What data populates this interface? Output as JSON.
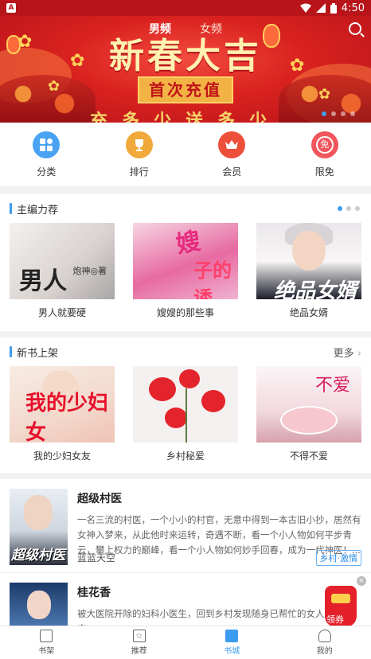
{
  "status_bar": {
    "time": "4:50"
  },
  "banner": {
    "tabs": [
      {
        "label": "男频"
      },
      {
        "label": "女频"
      }
    ],
    "title": "新春大吉",
    "button_label": "首次充值",
    "bottom_text": "充多少送多少"
  },
  "quick_nav": [
    {
      "label": "分类",
      "icon": "category-icon",
      "color": "#4aa3f2"
    },
    {
      "label": "排行",
      "icon": "trophy-icon",
      "color": "#f0a93a"
    },
    {
      "label": "会员",
      "icon": "crown-icon",
      "color": "#ee4f3b"
    },
    {
      "label": "限免",
      "icon": "free-icon",
      "color": "#f0565c"
    }
  ],
  "editor_picks": {
    "title": "主编力荐",
    "books": [
      {
        "title": "男人就要硬",
        "cover_text": "男人",
        "cover_author": "炮神◎著"
      },
      {
        "title": "嫂嫂的那些事",
        "cover_text": "嫂",
        "cover_text2": "子的诱"
      },
      {
        "title": "绝品女婿",
        "cover_text": "绝品女婿"
      }
    ]
  },
  "new_books": {
    "title": "新书上架",
    "more_label": "更多",
    "books": [
      {
        "title": "我的少妇女友",
        "cover_text": "我的少妇女"
      },
      {
        "title": "乡村秘爱"
      },
      {
        "title": "不得不爱",
        "cover_text": "不爱"
      }
    ]
  },
  "book_list": [
    {
      "title": "超级村医",
      "description": "一名三流的村医，一个小小的村官，无意中得到一本古旧小抄，居然有女神入梦来，从此他时来运转，奇遇不断，看一个小人物如何平步青云，攀上权力的巅峰，看一个小人物如何妙手回春，成为一代神医！...",
      "author": "蓝蓝天空",
      "tag": "乡村·激情",
      "cover_text": "超级村医"
    },
    {
      "title": "桂花香",
      "description": "被大医院开除的妇科小医生，回到乡村发现随身已帮忙的女人还得来……"
    }
  ],
  "coupon": {
    "label": "领券"
  },
  "tab_bar": [
    {
      "label": "书架",
      "icon": "bookshelf-icon",
      "active": false
    },
    {
      "label": "推荐",
      "icon": "star-icon",
      "active": false
    },
    {
      "label": "书城",
      "icon": "bookstore-icon",
      "active": true
    },
    {
      "label": "我的",
      "icon": "person-icon",
      "active": false
    }
  ]
}
